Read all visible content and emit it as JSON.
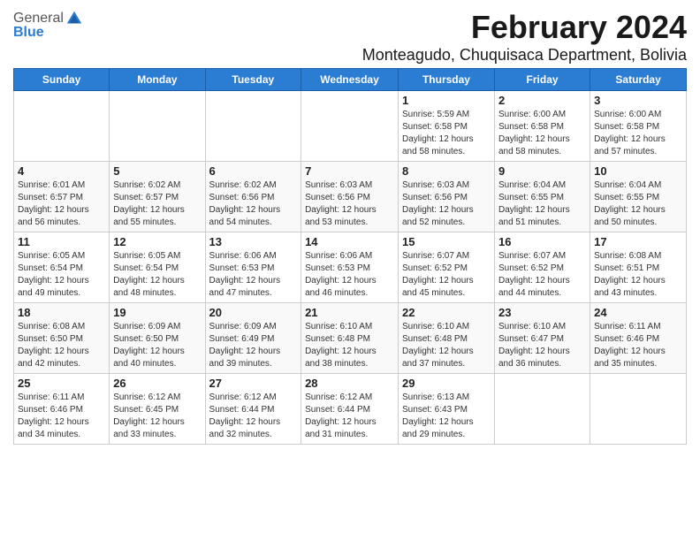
{
  "app": {
    "logo_general": "General",
    "logo_blue": "Blue",
    "title": "February 2024",
    "subtitle": "Monteagudo, Chuquisaca Department, Bolivia"
  },
  "calendar": {
    "headers": [
      "Sunday",
      "Monday",
      "Tuesday",
      "Wednesday",
      "Thursday",
      "Friday",
      "Saturday"
    ],
    "weeks": [
      [
        {
          "day": "",
          "info": ""
        },
        {
          "day": "",
          "info": ""
        },
        {
          "day": "",
          "info": ""
        },
        {
          "day": "",
          "info": ""
        },
        {
          "day": "1",
          "info": "Sunrise: 5:59 AM\nSunset: 6:58 PM\nDaylight: 12 hours\nand 58 minutes."
        },
        {
          "day": "2",
          "info": "Sunrise: 6:00 AM\nSunset: 6:58 PM\nDaylight: 12 hours\nand 58 minutes."
        },
        {
          "day": "3",
          "info": "Sunrise: 6:00 AM\nSunset: 6:58 PM\nDaylight: 12 hours\nand 57 minutes."
        }
      ],
      [
        {
          "day": "4",
          "info": "Sunrise: 6:01 AM\nSunset: 6:57 PM\nDaylight: 12 hours\nand 56 minutes."
        },
        {
          "day": "5",
          "info": "Sunrise: 6:02 AM\nSunset: 6:57 PM\nDaylight: 12 hours\nand 55 minutes."
        },
        {
          "day": "6",
          "info": "Sunrise: 6:02 AM\nSunset: 6:56 PM\nDaylight: 12 hours\nand 54 minutes."
        },
        {
          "day": "7",
          "info": "Sunrise: 6:03 AM\nSunset: 6:56 PM\nDaylight: 12 hours\nand 53 minutes."
        },
        {
          "day": "8",
          "info": "Sunrise: 6:03 AM\nSunset: 6:56 PM\nDaylight: 12 hours\nand 52 minutes."
        },
        {
          "day": "9",
          "info": "Sunrise: 6:04 AM\nSunset: 6:55 PM\nDaylight: 12 hours\nand 51 minutes."
        },
        {
          "day": "10",
          "info": "Sunrise: 6:04 AM\nSunset: 6:55 PM\nDaylight: 12 hours\nand 50 minutes."
        }
      ],
      [
        {
          "day": "11",
          "info": "Sunrise: 6:05 AM\nSunset: 6:54 PM\nDaylight: 12 hours\nand 49 minutes."
        },
        {
          "day": "12",
          "info": "Sunrise: 6:05 AM\nSunset: 6:54 PM\nDaylight: 12 hours\nand 48 minutes."
        },
        {
          "day": "13",
          "info": "Sunrise: 6:06 AM\nSunset: 6:53 PM\nDaylight: 12 hours\nand 47 minutes."
        },
        {
          "day": "14",
          "info": "Sunrise: 6:06 AM\nSunset: 6:53 PM\nDaylight: 12 hours\nand 46 minutes."
        },
        {
          "day": "15",
          "info": "Sunrise: 6:07 AM\nSunset: 6:52 PM\nDaylight: 12 hours\nand 45 minutes."
        },
        {
          "day": "16",
          "info": "Sunrise: 6:07 AM\nSunset: 6:52 PM\nDaylight: 12 hours\nand 44 minutes."
        },
        {
          "day": "17",
          "info": "Sunrise: 6:08 AM\nSunset: 6:51 PM\nDaylight: 12 hours\nand 43 minutes."
        }
      ],
      [
        {
          "day": "18",
          "info": "Sunrise: 6:08 AM\nSunset: 6:50 PM\nDaylight: 12 hours\nand 42 minutes."
        },
        {
          "day": "19",
          "info": "Sunrise: 6:09 AM\nSunset: 6:50 PM\nDaylight: 12 hours\nand 40 minutes."
        },
        {
          "day": "20",
          "info": "Sunrise: 6:09 AM\nSunset: 6:49 PM\nDaylight: 12 hours\nand 39 minutes."
        },
        {
          "day": "21",
          "info": "Sunrise: 6:10 AM\nSunset: 6:48 PM\nDaylight: 12 hours\nand 38 minutes."
        },
        {
          "day": "22",
          "info": "Sunrise: 6:10 AM\nSunset: 6:48 PM\nDaylight: 12 hours\nand 37 minutes."
        },
        {
          "day": "23",
          "info": "Sunrise: 6:10 AM\nSunset: 6:47 PM\nDaylight: 12 hours\nand 36 minutes."
        },
        {
          "day": "24",
          "info": "Sunrise: 6:11 AM\nSunset: 6:46 PM\nDaylight: 12 hours\nand 35 minutes."
        }
      ],
      [
        {
          "day": "25",
          "info": "Sunrise: 6:11 AM\nSunset: 6:46 PM\nDaylight: 12 hours\nand 34 minutes."
        },
        {
          "day": "26",
          "info": "Sunrise: 6:12 AM\nSunset: 6:45 PM\nDaylight: 12 hours\nand 33 minutes."
        },
        {
          "day": "27",
          "info": "Sunrise: 6:12 AM\nSunset: 6:44 PM\nDaylight: 12 hours\nand 32 minutes."
        },
        {
          "day": "28",
          "info": "Sunrise: 6:12 AM\nSunset: 6:44 PM\nDaylight: 12 hours\nand 31 minutes."
        },
        {
          "day": "29",
          "info": "Sunrise: 6:13 AM\nSunset: 6:43 PM\nDaylight: 12 hours\nand 29 minutes."
        },
        {
          "day": "",
          "info": ""
        },
        {
          "day": "",
          "info": ""
        }
      ]
    ]
  }
}
